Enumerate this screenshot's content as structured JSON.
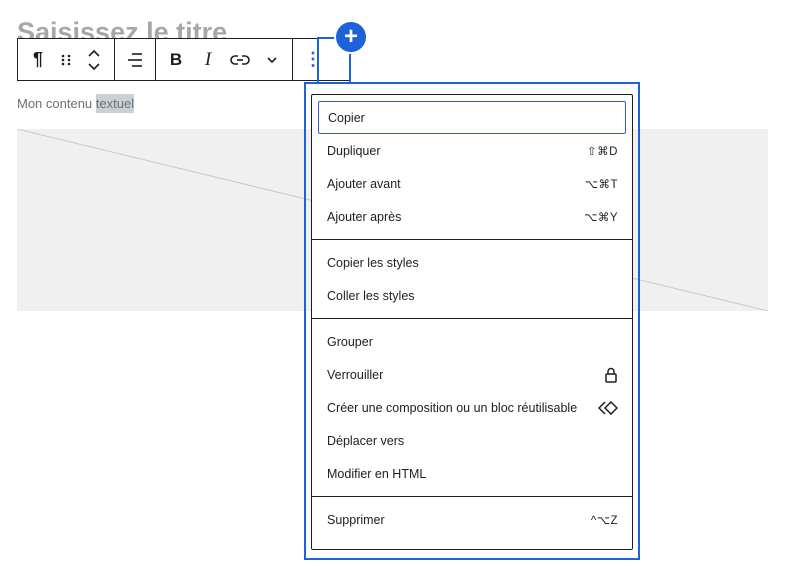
{
  "page": {
    "title": "Saisissez le titre"
  },
  "content": {
    "text_before": "Mon contenu ",
    "text_selected": "textuel"
  },
  "toolbar": {
    "paragraph": "¶",
    "bold": "B",
    "italic": "I",
    "more": "⋮",
    "icons": [
      "paragraph-icon",
      "drag-handle-icon",
      "move-up-down-icon",
      "align-icon",
      "bold-icon",
      "italic-icon",
      "link-icon",
      "chevron-down-icon",
      "more-options-icon"
    ]
  },
  "add_block": {
    "label": "+"
  },
  "menu": {
    "groups": [
      {
        "items": [
          {
            "label": "Copier",
            "shortcut": ""
          },
          {
            "label": "Dupliquer",
            "shortcut": "⇧⌘D"
          },
          {
            "label": "Ajouter avant",
            "shortcut": "⌥⌘T"
          },
          {
            "label": "Ajouter après",
            "shortcut": "⌥⌘Y"
          }
        ]
      },
      {
        "items": [
          {
            "label": "Copier les styles",
            "shortcut": ""
          },
          {
            "label": "Coller les styles",
            "shortcut": ""
          }
        ]
      },
      {
        "items": [
          {
            "label": "Grouper",
            "shortcut": ""
          },
          {
            "label": "Verrouiller",
            "icon": "lock-icon"
          },
          {
            "label": "Créer une composition ou un bloc réutilisable",
            "icon": "symbol-icon"
          },
          {
            "label": "Déplacer vers",
            "shortcut": ""
          },
          {
            "label": "Modifier en HTML",
            "shortcut": ""
          }
        ]
      },
      {
        "items": [
          {
            "label": "Supprimer",
            "shortcut": "^⌥Z"
          }
        ]
      }
    ]
  },
  "colors": {
    "accent": "#3858e9",
    "focus": "#1e62d8",
    "title": "#a7a7a7"
  }
}
